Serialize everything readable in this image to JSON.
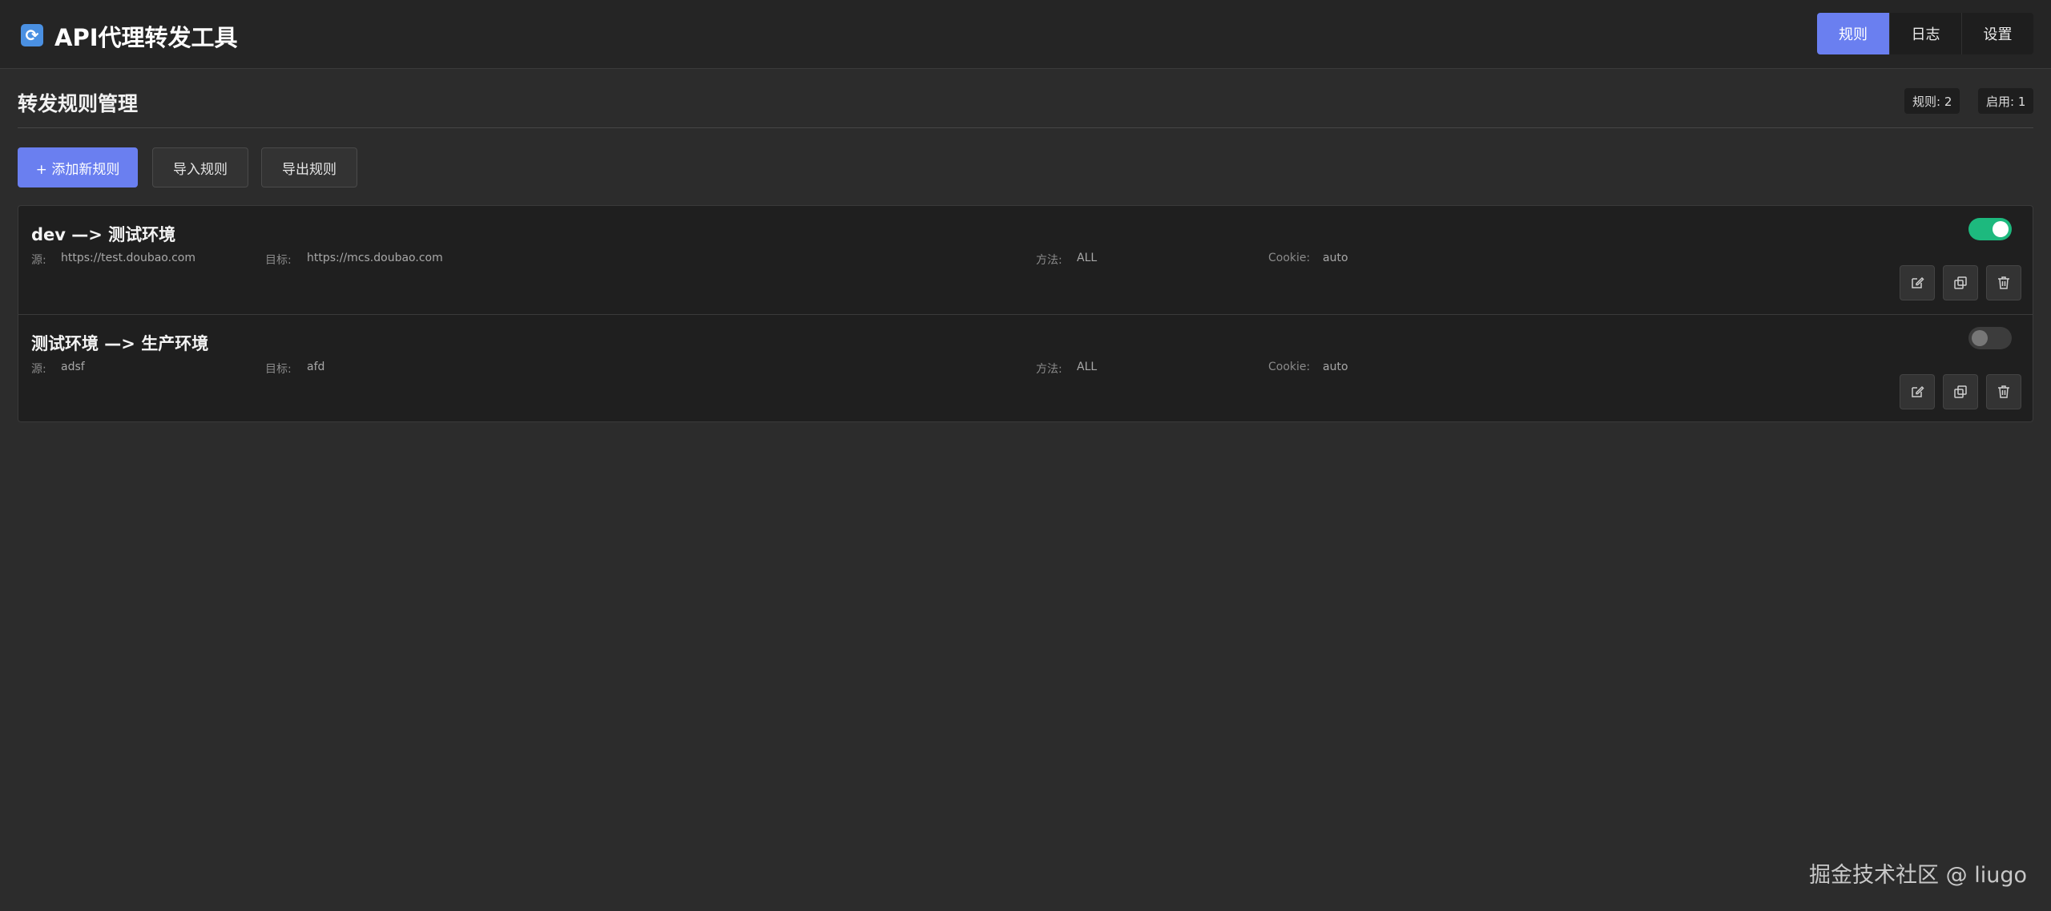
{
  "header": {
    "app_icon": "refresh-icon",
    "app_icon_glyph": "⟳",
    "title": "API代理转发工具",
    "tabs": [
      {
        "label": "规则",
        "active": true
      },
      {
        "label": "日志",
        "active": false
      },
      {
        "label": "设置",
        "active": false
      }
    ]
  },
  "main": {
    "title": "转发规则管理",
    "stats": {
      "rules": "规则: 2",
      "enabled": "启用: 1"
    },
    "toolbar": {
      "add_label": "+ 添加新规则",
      "import_label": "导入规则",
      "export_label": "导出规则"
    },
    "field_labels": {
      "source": "源:",
      "target": "目标:",
      "method": "方法:",
      "cookie": "Cookie:"
    },
    "rules": [
      {
        "name": "dev —> 测试环境",
        "source": "https://test.doubao.com",
        "target": "https://mcs.doubao.com",
        "method": "ALL",
        "cookie": "auto",
        "enabled": true
      },
      {
        "name": "测试环境 —> 生产环境",
        "source": "adsf",
        "target": "afd",
        "method": "ALL",
        "cookie": "auto",
        "enabled": false
      }
    ],
    "actions": [
      "edit-icon",
      "copy-icon",
      "trash-icon"
    ]
  },
  "colors": {
    "background": "#2c2c2c",
    "header": "#252525",
    "accent": "#6a7ff0",
    "toggle_on": "#1db97e",
    "toggle_off": "#3c3c3c",
    "card": "#1f1f1f"
  },
  "watermark": "掘金技术社区 @ liugo"
}
